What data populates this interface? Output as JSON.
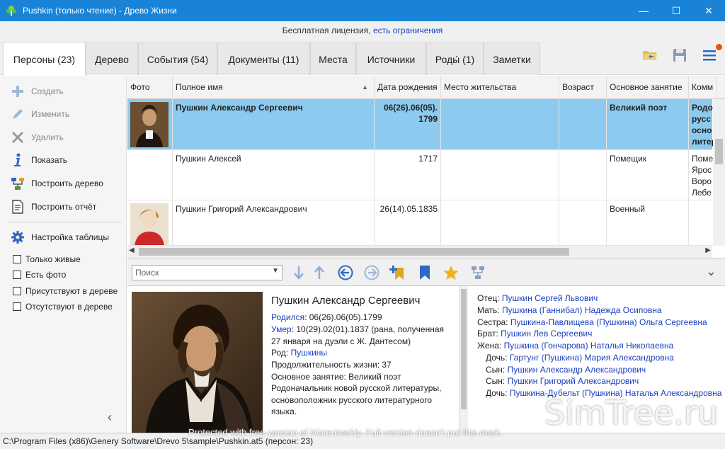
{
  "window": {
    "title": "Pushkin (только чтение) - Древо Жизни",
    "minimize": "—",
    "maximize": "☐",
    "close": "✕"
  },
  "license": {
    "text": "Бесплатная лицензия, ",
    "link": "есть ограничения"
  },
  "tabs": [
    {
      "label": "Персоны (23)"
    },
    {
      "label": "Дерево"
    },
    {
      "label": "События (54)"
    },
    {
      "label": "Документы (11)"
    },
    {
      "label": "Места"
    },
    {
      "label": "Источники"
    },
    {
      "label": "Роды́ (1)"
    },
    {
      "label": "Заметки"
    }
  ],
  "sidebar": {
    "create": "Создать",
    "edit": "Изменить",
    "delete": "Удалить",
    "show": "Показать",
    "build_tree": "Построить дерево",
    "build_report": "Построить отчёт",
    "table_settings": "Настройка таблицы",
    "filters": [
      "Только живые",
      "Есть фото",
      "Присутствуют в дереве",
      "Отсутствуют в дереве"
    ],
    "collapse": "‹"
  },
  "grid": {
    "columns": [
      "Фото",
      "Полное имя",
      "Дата рождения",
      "Место жительства",
      "Возраст",
      "Основное занятие",
      "Комм"
    ],
    "sort_indicator": "▲",
    "rows": [
      {
        "name": "Пушкин Александр Сергеевич",
        "birth": "06(26).06(05).\n1799",
        "residence": "",
        "age": "",
        "occupation": "Великий поэт",
        "comment": "Родо\nрусс\nосно\nлитер"
      },
      {
        "name": "Пушкин Алексей",
        "birth": "1717",
        "residence": "",
        "age": "",
        "occupation": "Помещик",
        "comment": "Поме\nЯрос\nВоро\nЛебе"
      },
      {
        "name": "Пушкин Григорий Александрович",
        "birth": "26(14).05.1835",
        "residence": "",
        "age": "",
        "occupation": "Военный",
        "comment": ""
      }
    ]
  },
  "navbar": {
    "search_placeholder": "Поиск",
    "expand": "⌄"
  },
  "detail": {
    "name": "Пушкин Александр Сергеевич",
    "born_label": "Родился",
    "born_value": ": 06(26).06(05).1799",
    "died_label": "Умер",
    "died_value": ": 10(29).02(01).1837 (рана, полученная 27 января на дуэли с Ж. Дантесом)",
    "clan_label": "Род: ",
    "clan_value": "Пушкины",
    "lifespan": "Продолжительность жизни: 37",
    "occupation": "Основное занятие: Великий поэт",
    "comment": "Родоначальник новой русской литературы, основоположник русского литературного языка."
  },
  "relatives": [
    {
      "role": "Отец: ",
      "name": "Пушкин Сергей Львович",
      "indent": false
    },
    {
      "role": "Мать: ",
      "name": "Пушкина (Ганнибал) Надежда Осиповна",
      "indent": false
    },
    {
      "role": "Сестра: ",
      "name": "Пушкина-Павлищева (Пушкина) Ольга Сергеевна",
      "indent": false
    },
    {
      "role": "Брат: ",
      "name": "Пушкин Лев Сергеевич",
      "indent": false
    },
    {
      "role": "Жена: ",
      "name": "Пушкина (Гончарова) Наталья Николаевна",
      "indent": false
    },
    {
      "role": "Дочь: ",
      "name": "Гартунг (Пушкина) Мария Александровна",
      "indent": true
    },
    {
      "role": "Сын: ",
      "name": "Пушкин Александр Александрович",
      "indent": true
    },
    {
      "role": "Сын: ",
      "name": "Пушкин Григорий Александрович",
      "indent": true
    },
    {
      "role": "Дочь: ",
      "name": "Пушкина-Дубельт (Пушкина) Наталья Александровна",
      "indent": true
    }
  ],
  "status": {
    "path": "C:\\Program Files (x86)\\Genery Software\\Drevo 5\\sample\\Pushkin.at5 (персон: 23)"
  },
  "overlay": {
    "watermark": "Protected with free version of Watermarkly. Full version doesn't put this mark.",
    "site": "SimTree.ru"
  },
  "colors": {
    "titlebar": "#1883d7",
    "selection": "#8ccbef",
    "link": "#1a3fc0",
    "notification": "#e8540c"
  }
}
